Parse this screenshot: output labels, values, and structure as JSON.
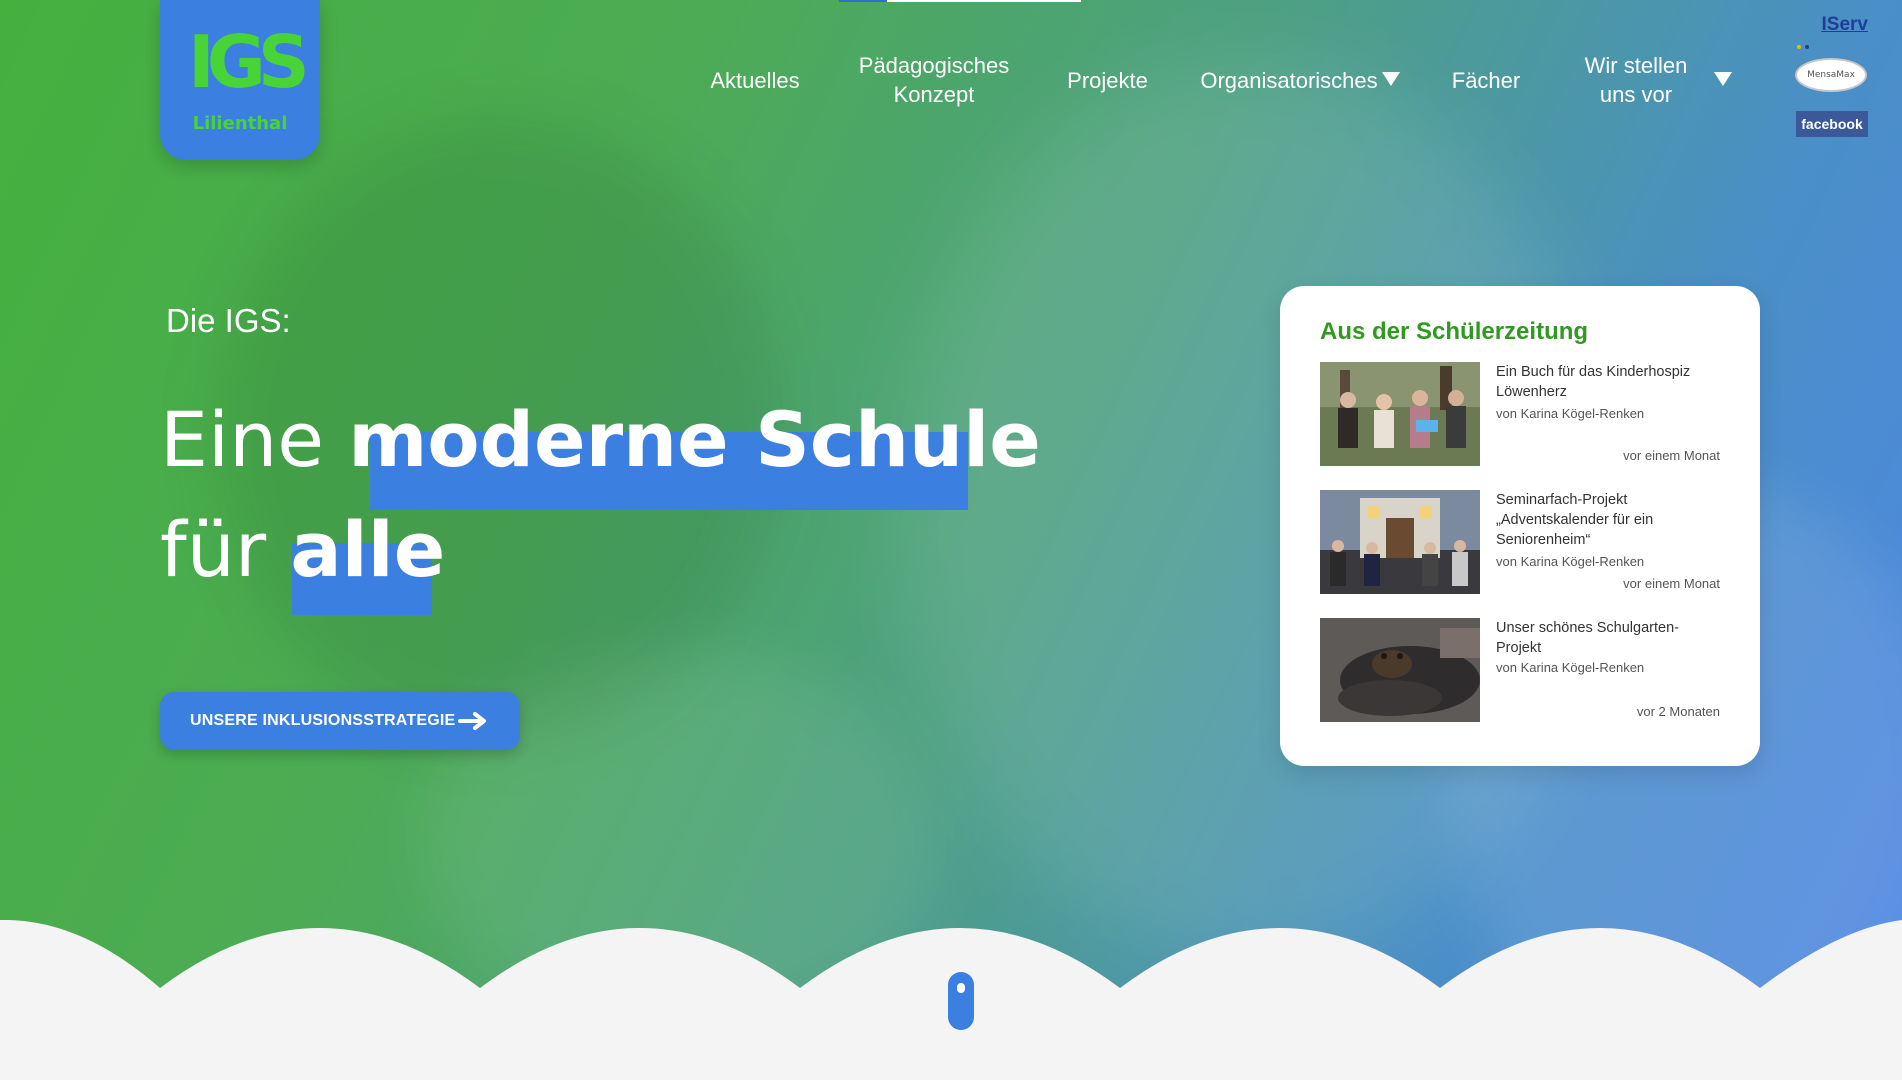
{
  "header": {
    "logo": {
      "mark": "IGS",
      "sub": "Lilienthal",
      "color": "#48d437",
      "bg": "#3b7fe0"
    },
    "nav": [
      {
        "label": "Aktuelles"
      },
      {
        "label": "Pädagogisches Konzept"
      },
      {
        "label": "Projekte"
      },
      {
        "label": "Organisatorisches",
        "has_dropdown": true
      },
      {
        "label": "Fächer"
      },
      {
        "label": "Wir stellen uns vor",
        "has_dropdown": true
      }
    ],
    "external_links": {
      "iserv": "IServ",
      "mensamax": "MensaMax",
      "facebook": "facebook"
    }
  },
  "hero": {
    "kicker": "Die IGS:",
    "headline_line1_plain": "Eine ",
    "headline_line1_highlight": "moderne Schule",
    "headline_line2_plain": "für ",
    "headline_line2_highlight": "alle",
    "cta_label": "UNSERE INKLUSIONSSTRATEGIE",
    "gradient_colors": [
      "#45b03e",
      "#4f86e6"
    ],
    "highlight_color": "#3b7fe0"
  },
  "news_card": {
    "title": "Aus der Schülerzeitung",
    "title_color": "#2f9a1f",
    "items": [
      {
        "title": "Ein Buch für das Kinderhospiz Löwenherz",
        "author": "von Karina Kögel-Renken",
        "time": "vor einem Monat",
        "thumb_icon": "group-photo-icon"
      },
      {
        "title": "Seminarfach-Projekt „Adventskalender für ein Seniorenheim“",
        "author": "von Karina Kögel-Renken",
        "time": "vor einem Monat",
        "thumb_icon": "building-photo-icon"
      },
      {
        "title": "Unser schönes Schulgarten-Projekt",
        "author": "von Karina Kögel-Renken",
        "time": "vor 2 Monaten",
        "thumb_icon": "toad-photo-icon"
      }
    ]
  }
}
